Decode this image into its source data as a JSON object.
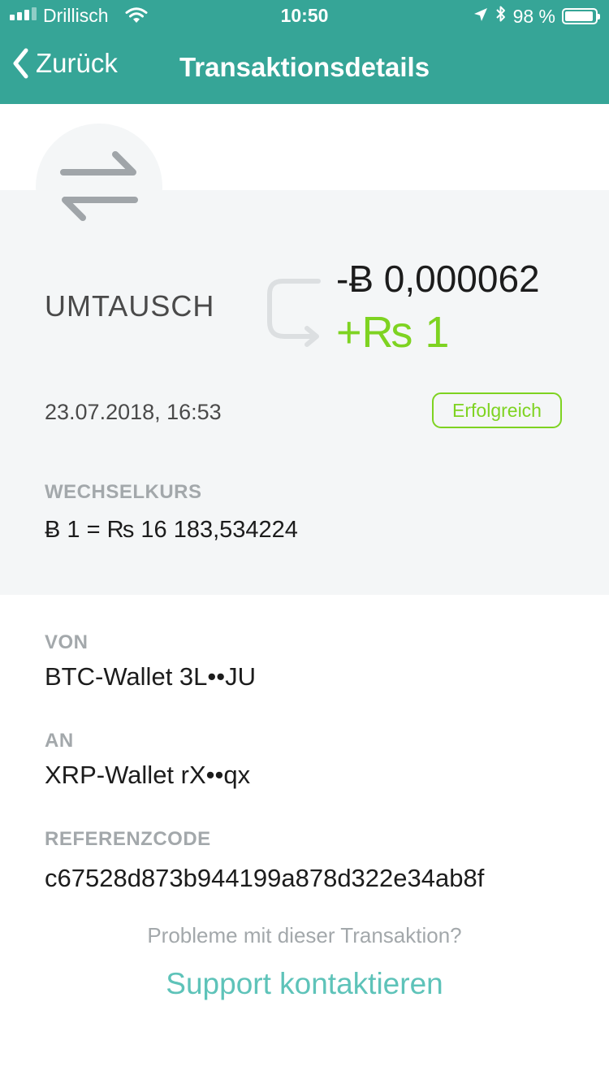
{
  "status_bar": {
    "carrier": "Drillisch",
    "time": "10:50",
    "battery": "98 %"
  },
  "nav": {
    "back_label": "Zurück",
    "title": "Transaktionsdetails"
  },
  "transaction": {
    "type": "UMTAUSCH",
    "amount_out": "-Ƀ 0,000062",
    "amount_in": "+₨ 1",
    "datetime": "23.07.2018, 16:53",
    "status": "Erfolgreich",
    "exchange_rate_label": "WECHSELKURS",
    "exchange_rate": "Ƀ 1 = ₨ 16 183,534224"
  },
  "details": {
    "from_label": "VON",
    "from_value": "BTC-Wallet 3L••JU",
    "to_label": "AN",
    "to_value": "XRP-Wallet rX••qx",
    "reference_label": "REFERENZCODE",
    "reference_value": "c67528d873b944199a878d322e34ab8f"
  },
  "footer": {
    "help_text": "Probleme mit dieser Transaktion?",
    "support_label": "Support kontaktieren"
  },
  "colors": {
    "header": "#36a597",
    "success": "#7ed321",
    "link": "#5ec3b9",
    "panel": "#f4f6f7",
    "muted": "#a3a8ab"
  },
  "icons": [
    "signal-icon",
    "wifi-icon",
    "location-icon",
    "bluetooth-icon",
    "battery-icon",
    "back-chevron-icon",
    "swap-arrows-icon",
    "exchange-flow-icon"
  ]
}
